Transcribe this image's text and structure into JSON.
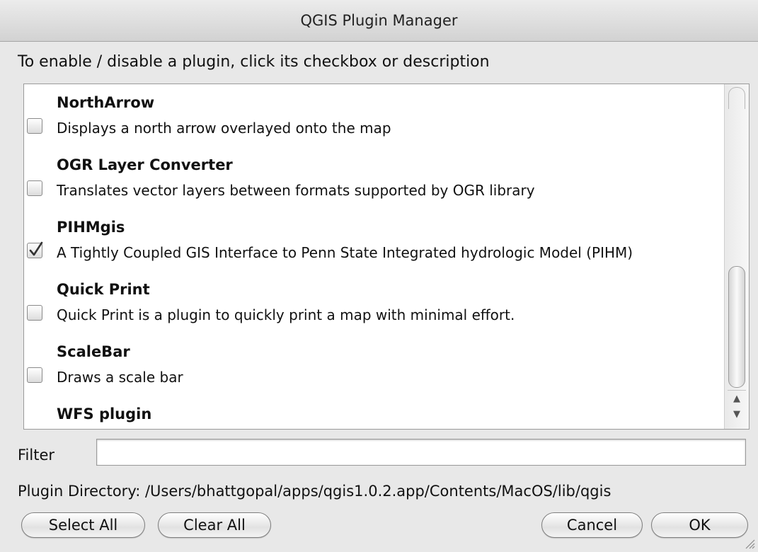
{
  "window": {
    "title": "QGIS Plugin Manager"
  },
  "instructions": "To enable / disable a plugin, click its checkbox or description",
  "plugins": [
    {
      "name": "NorthArrow",
      "description": "Displays a north arrow overlayed onto the map",
      "checked": false
    },
    {
      "name": "OGR Layer Converter",
      "description": "Translates vector layers between formats supported by OGR library",
      "checked": false
    },
    {
      "name": "PIHMgis",
      "description": "A Tightly Coupled GIS Interface to Penn State Integrated hydrologic Model (PIHM)",
      "checked": true
    },
    {
      "name": "Quick Print",
      "description": "Quick Print is a plugin to quickly print a map with minimal effort.",
      "checked": false
    },
    {
      "name": "ScaleBar",
      "description": "Draws a scale bar",
      "checked": false
    },
    {
      "name": "WFS plugin",
      "description": "",
      "checked": false
    }
  ],
  "filter": {
    "label": "Filter",
    "value": ""
  },
  "plugin_directory": "Plugin Directory:  /Users/bhattgopal/apps/qgis1.0.2.app/Contents/MacOS/lib/qgis",
  "buttons": {
    "select_all": "Select All",
    "clear_all": "Clear All",
    "cancel": "Cancel",
    "ok": "OK"
  },
  "scrollbar": {
    "up_arrow": "▲",
    "down_arrow": "▼"
  }
}
